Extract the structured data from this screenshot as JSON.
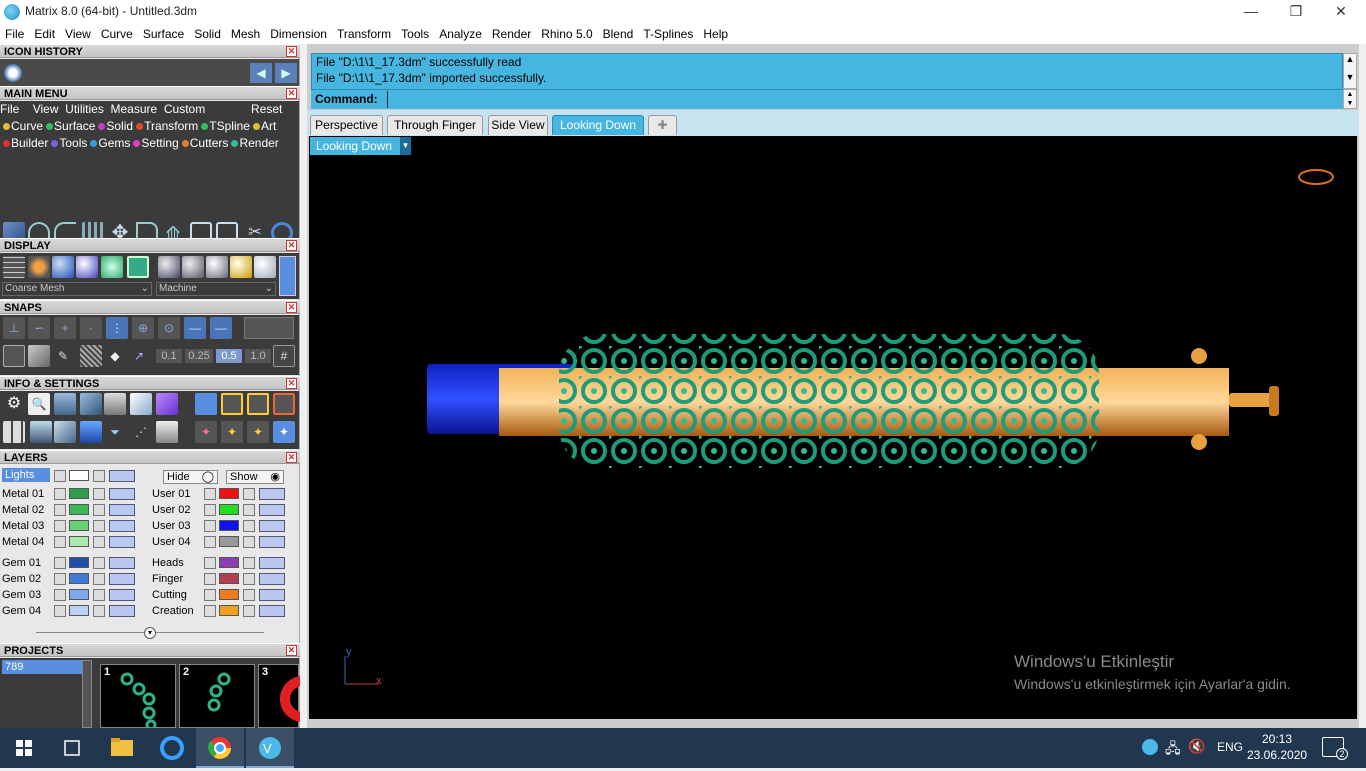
{
  "window": {
    "title": "Matrix 8.0 (64-bit) - Untitled.3dm"
  },
  "menubar": [
    "File",
    "Edit",
    "View",
    "Curve",
    "Surface",
    "Solid",
    "Mesh",
    "Dimension",
    "Transform",
    "Tools",
    "Analyze",
    "Render",
    "Rhino 5.0",
    "Blend",
    "T-Splines",
    "Help"
  ],
  "panels": {
    "icon_history": "ICON HISTORY",
    "main_menu": "MAIN MENU",
    "display": "DISPLAY",
    "snaps": "SNAPS",
    "info_settings": "INFO & SETTINGS",
    "layers": "LAYERS",
    "projects": "PROJECTS"
  },
  "main_menu": {
    "row1": [
      "File",
      "View",
      "Utilities",
      "Measure",
      "Custom"
    ],
    "reset": "Reset",
    "row2": [
      {
        "label": "Curve",
        "color": "#e0c030"
      },
      {
        "label": "Surface",
        "color": "#30c060"
      },
      {
        "label": "Solid",
        "color": "#c040c0"
      },
      {
        "label": "Transform",
        "color": "#e05020"
      },
      {
        "label": "TSpline",
        "color": "#30c060"
      },
      {
        "label": "Art",
        "color": "#e0c030"
      }
    ],
    "row3": [
      {
        "label": "Builder",
        "color": "#e03030"
      },
      {
        "label": "Tools",
        "color": "#8060e0"
      },
      {
        "label": "Gems",
        "color": "#30a0e0"
      },
      {
        "label": "Setting",
        "color": "#e040c0"
      },
      {
        "label": "Cutters",
        "color": "#e08030"
      },
      {
        "label": "Render",
        "color": "#30c0a0"
      }
    ]
  },
  "display": {
    "mesh_select": "Coarse Mesh",
    "material_select": "Machine"
  },
  "snaps": {
    "values": [
      "0.1",
      "0.25",
      "0.5",
      "1.0"
    ],
    "selected": "0.5"
  },
  "layers": {
    "lights": "Lights",
    "hide": "Hide",
    "show": "Show",
    "left": [
      {
        "name": "Metal 01",
        "color": "#2e9e4e"
      },
      {
        "name": "Metal 02",
        "color": "#3ab85a"
      },
      {
        "name": "Metal 03",
        "color": "#66d37a"
      },
      {
        "name": "Metal 04",
        "color": "#a8ebb0"
      },
      {
        "name": "Gem 01",
        "color": "#1f4fa8"
      },
      {
        "name": "Gem 02",
        "color": "#3f79d6"
      },
      {
        "name": "Gem 03",
        "color": "#7ea9ee"
      },
      {
        "name": "Gem 04",
        "color": "#b9d1f6"
      }
    ],
    "right": [
      {
        "name": "User 01",
        "color": "#ee1111"
      },
      {
        "name": "User 02",
        "color": "#22dd22"
      },
      {
        "name": "User 03",
        "color": "#1111ee"
      },
      {
        "name": "User 04",
        "color": "#999999"
      },
      {
        "name": "Heads",
        "color": "#8a3fb0"
      },
      {
        "name": "Finger",
        "color": "#b04050"
      },
      {
        "name": "Cutting",
        "color": "#f07a20"
      },
      {
        "name": "Creation",
        "color": "#f0a020"
      }
    ]
  },
  "projects": {
    "current": "789",
    "thumbs": [
      "1",
      "2",
      "3"
    ]
  },
  "command": {
    "history": [
      "File \"D:\\1\\1_17.3dm\" successfully read",
      "File \"D:\\1\\1_17.3dm\" imported successfully."
    ],
    "prompt": "Command:",
    "value": ""
  },
  "viewport_tabs": [
    "Perspective",
    "Through Finger",
    "Side View",
    "Looking Down"
  ],
  "active_tab": "Looking Down",
  "viewport_label": "Looking Down",
  "axes": {
    "x": "x",
    "y": "y"
  },
  "watermark": {
    "line1": "Windows'u Etkinleştir",
    "line2": "Windows'u etkinleştirmek için Ayarlar'a gidin."
  },
  "taskbar": {
    "lang": "ENG",
    "time": "20:13",
    "date": "23.06.2020",
    "notif_count": "2"
  }
}
